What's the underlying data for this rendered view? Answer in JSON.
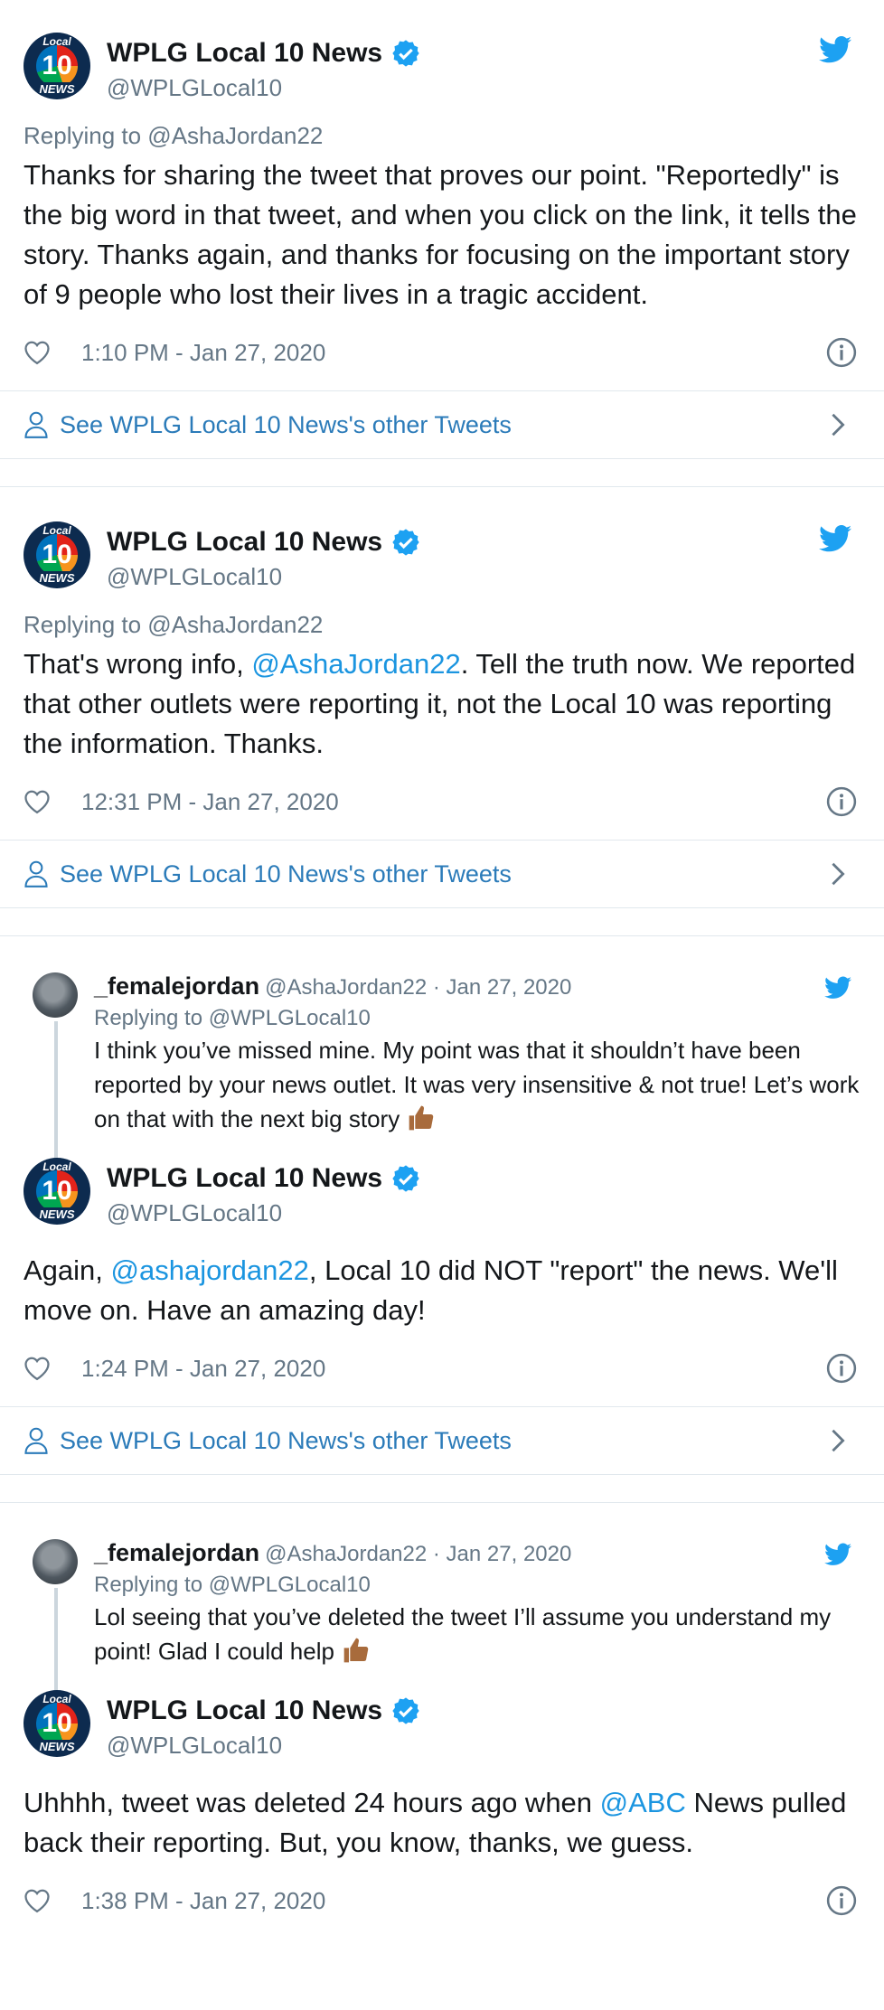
{
  "account": {
    "name": "WPLG Local 10 News",
    "handle": "@WPLGLocal10",
    "avatar_top": "Local",
    "avatar_num": "10",
    "avatar_bot": "NEWS",
    "abc": "abc"
  },
  "other_tweets_label": "See WPLG Local 10 News's other Tweets",
  "colors": {
    "link": "#1b95e0",
    "meta": "#657786",
    "divider": "#e1e8ed",
    "twitter_blue": "#1da1f2"
  },
  "tweets": [
    {
      "replying": "Replying to @AshaJordan22",
      "text": "Thanks for sharing the tweet that proves our point.  \"Reportedly\" is the big word in that tweet, and when you click on the link, it tells the story. Thanks again, and thanks for focusing on the important story of 9 people who lost their lives in a tragic accident.",
      "time": "1:10 PM - Jan 27, 2020"
    },
    {
      "replying": "Replying to @AshaJordan22",
      "text_a": "That's wrong info, ",
      "mention": "@AshaJordan22",
      "text_b": ". Tell the truth now. We reported that other outlets were reporting it, not the Local 10 was reporting the information. Thanks.",
      "time": "12:31 PM - Jan 27, 2020"
    },
    {
      "quoted": {
        "name": "_femalejordan",
        "handle_date": "@AshaJordan22 · Jan 27, 2020",
        "replying": "Replying to @WPLGLocal10",
        "text": "I think you’ve missed mine. My point was that it shouldn’t have been reported by your news outlet. It was very insensitive & not true! Let’s work on that with the next big story"
      },
      "text_a": "Again, ",
      "mention": "@ashajordan22",
      "text_b": ", Local 10 did NOT \"report\" the news. We'll move on. Have an amazing day!",
      "time": "1:24 PM - Jan 27, 2020"
    },
    {
      "quoted": {
        "name": "_femalejordan",
        "handle_date": "@AshaJordan22 · Jan 27, 2020",
        "replying": "Replying to @WPLGLocal10",
        "text": "Lol seeing that you’ve deleted the tweet I’ll assume you understand my point! Glad I could help"
      },
      "text_a": "Uhhhh, tweet was deleted 24 hours ago when ",
      "mention": "@ABC",
      "text_b": " News pulled back their reporting. But, you know, thanks, we guess.",
      "time": "1:38 PM - Jan 27, 2020"
    }
  ]
}
